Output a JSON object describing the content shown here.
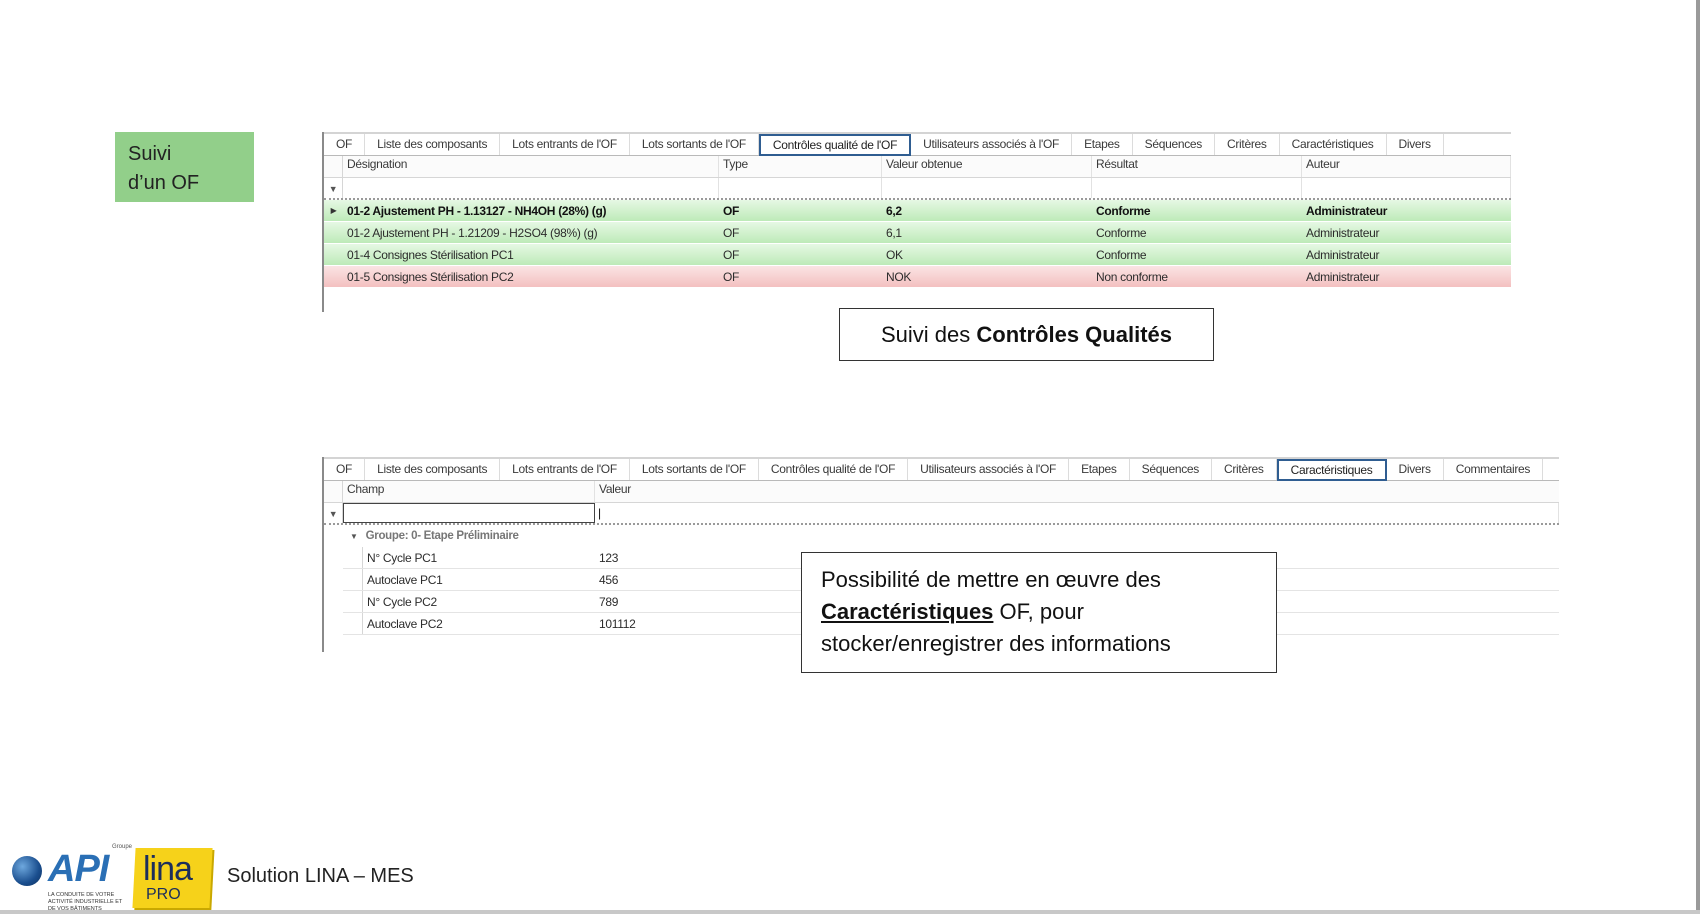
{
  "section_label": [
    "Suivi",
    "d’un OF"
  ],
  "grid1": {
    "tabs": [
      "OF",
      "Liste des composants",
      "Lots entrants de l'OF",
      "Lots sortants de l'OF",
      "Contrôles qualité de l'OF",
      "Utilisateurs associés à l'OF",
      "Etapes",
      "Séquences",
      "Critères",
      "Caractéristiques",
      "Divers"
    ],
    "active_tab": "Contrôles qualité de l'OF",
    "columns": [
      "Désignation",
      "Type",
      "Valeur obtenue",
      "Résultat",
      "Auteur"
    ],
    "rows": [
      {
        "designation": "01-2 Ajustement PH - 1.13127 - NH4OH (28%) (g)",
        "type": "OF",
        "valeur": "6,2",
        "resultat": "Conforme",
        "auteur": "Administrateur",
        "status": "green",
        "selected": true
      },
      {
        "designation": "01-2 Ajustement PH - 1.21209 - H2SO4 (98%) (g)",
        "type": "OF",
        "valeur": "6,1",
        "resultat": "Conforme",
        "auteur": "Administrateur",
        "status": "green",
        "selected": false
      },
      {
        "designation": "01-4 Consignes Stérilisation PC1",
        "type": "OF",
        "valeur": "OK",
        "resultat": "Conforme",
        "auteur": "Administrateur",
        "status": "green",
        "selected": false
      },
      {
        "designation": "01-5 Consignes Stérilisation PC2",
        "type": "OF",
        "valeur": "NOK",
        "resultat": "Non conforme",
        "auteur": "Administrateur",
        "status": "red",
        "selected": false
      }
    ]
  },
  "callout1": {
    "prefix": "Suivi des ",
    "bold": "Contrôles Qualités"
  },
  "grid2": {
    "tabs": [
      "OF",
      "Liste des composants",
      "Lots entrants de l'OF",
      "Lots sortants de l'OF",
      "Contrôles qualité de l'OF",
      "Utilisateurs associés à l'OF",
      "Etapes",
      "Séquences",
      "Critères",
      "Caractéristiques",
      "Divers",
      "Commentaires"
    ],
    "active_tab": "Caractéristiques",
    "columns": [
      "Champ",
      "Valeur"
    ],
    "filter_value": "|",
    "group": "Groupe: 0- Etape Préliminaire",
    "rows": [
      {
        "champ": "N° Cycle PC1",
        "valeur": "123"
      },
      {
        "champ": "Autoclave PC1",
        "valeur": "456"
      },
      {
        "champ": "N° Cycle PC2",
        "valeur": "789"
      },
      {
        "champ": "Autoclave PC2",
        "valeur": "101112"
      }
    ]
  },
  "callout2": {
    "line1": "Possibilité de mettre en œuvre des",
    "bold_underlined": "Caractéristiques",
    "line2_rest": " OF, pour",
    "line3": "stocker/enregistrer des informations"
  },
  "footer": {
    "title": "Solution LINA – MES",
    "api_logo": "API",
    "api_groupe": "Groupe",
    "api_tagline": "LA CONDUITE DE VOTRE ACTIVITÉ INDUSTRIELLE ET DE VOS BÂTIMENTS",
    "lina_logo": "lina",
    "pro_logo": "PRO"
  }
}
